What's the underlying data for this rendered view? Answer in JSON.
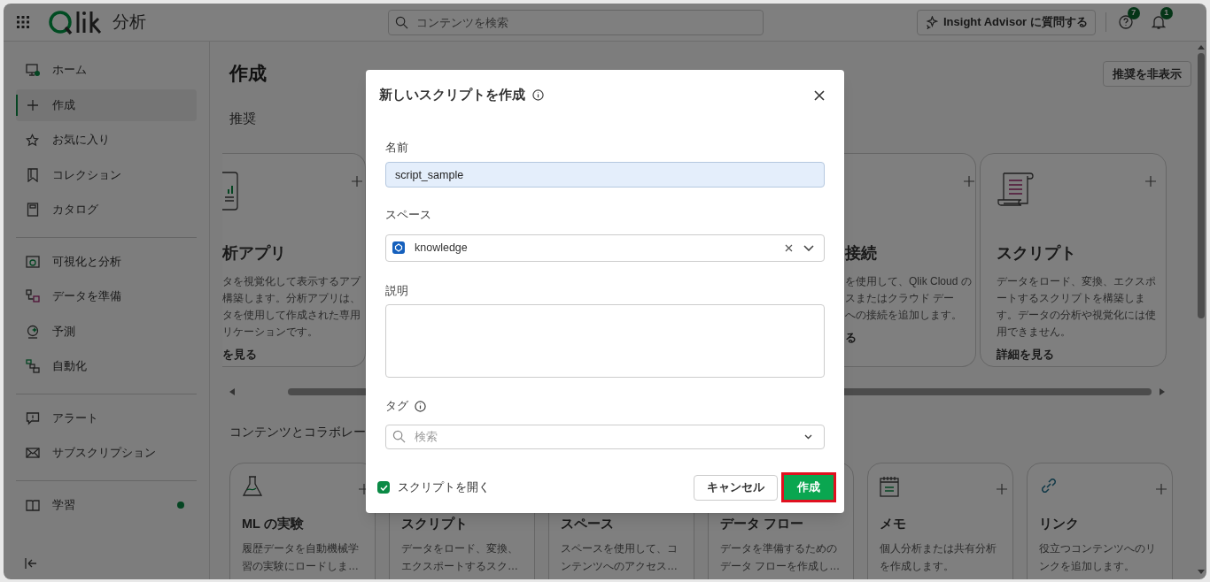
{
  "header": {
    "app_title": "分析",
    "search_placeholder": "コンテンツを検索",
    "advisor_button": "Insight Advisor に質問する",
    "help_badge": "7",
    "notification_badge": "1"
  },
  "sidebar": {
    "groups": [
      [
        {
          "label": "ホーム",
          "selected": false,
          "new": false
        },
        {
          "label": "作成",
          "selected": true,
          "new": false
        },
        {
          "label": "お気に入り",
          "selected": false,
          "new": false
        },
        {
          "label": "コレクション",
          "selected": false,
          "new": false
        },
        {
          "label": "カタログ",
          "selected": false,
          "new": false
        }
      ],
      [
        {
          "label": "可視化と分析",
          "selected": false,
          "new": false
        },
        {
          "label": "データを準備",
          "selected": false,
          "new": false
        },
        {
          "label": "予測",
          "selected": false,
          "new": false
        },
        {
          "label": "自動化",
          "selected": false,
          "new": false
        }
      ],
      [
        {
          "label": "アラート",
          "selected": false,
          "new": false
        },
        {
          "label": "サブスクリプション",
          "selected": false,
          "new": false
        }
      ],
      [
        {
          "label": "学習",
          "selected": false,
          "new": true
        }
      ]
    ]
  },
  "main": {
    "title": "作成",
    "hide_button": "推奨を非表示",
    "recommended_heading": "推奨",
    "recommended": [
      {
        "kind": "clipped-left",
        "title": "析アプリ",
        "description": [
          "タを視覚化して表示するアプ",
          "構築します。分析アプリは、",
          "タを使用して作成された専用",
          "リケーションです。"
        ],
        "link": "を見る"
      },
      {
        "kind": "clipped-left",
        "title": "接続",
        "description": [
          "を使用して、Qlik Cloud の",
          "スまたはクラウド デー",
          "への接続を追加します。"
        ],
        "link": "る"
      },
      {
        "kind": "full",
        "title": "スクリプト",
        "description": [
          "データをロード、変換、エクスポ",
          "ートするスクリプトを構築しま",
          "す。データの分析や視覚化には使",
          "用できません。"
        ],
        "link": "詳細を見る"
      }
    ],
    "content_heading": "コンテンツとコラボレー",
    "content_cards": [
      {
        "title": "ML の実験",
        "description": [
          "履歴データを自動機械学",
          "習の実験にロードしま…"
        ]
      },
      {
        "title": "スクリプト",
        "description": [
          "データをロード、変換、",
          "エクスポートするスク…"
        ]
      },
      {
        "title": "スペース",
        "description": [
          "スペースを使用して、コ",
          "ンテンツへのアクセス…"
        ]
      },
      {
        "title": "データ フロー",
        "description": [
          "データを準備するための",
          "データ フローを作成し…"
        ]
      },
      {
        "title": "メモ",
        "description": [
          "個人分析または共有分析",
          "を作成します。"
        ]
      },
      {
        "title": "リンク",
        "description": [
          "役立つコンテンツへのリ",
          "ンクを追加します。"
        ]
      }
    ]
  },
  "dialog": {
    "title": "新しいスクリプトを作成",
    "name_label": "名前",
    "name_value": "script_sample",
    "space_label": "スペース",
    "space_value": "knowledge",
    "description_label": "説明",
    "tag_label": "タグ",
    "tag_placeholder": "検索",
    "open_script": {
      "label": "スクリプトを開く",
      "checked": true
    },
    "cancel_button": "キャンセル",
    "create_button": "作成"
  }
}
